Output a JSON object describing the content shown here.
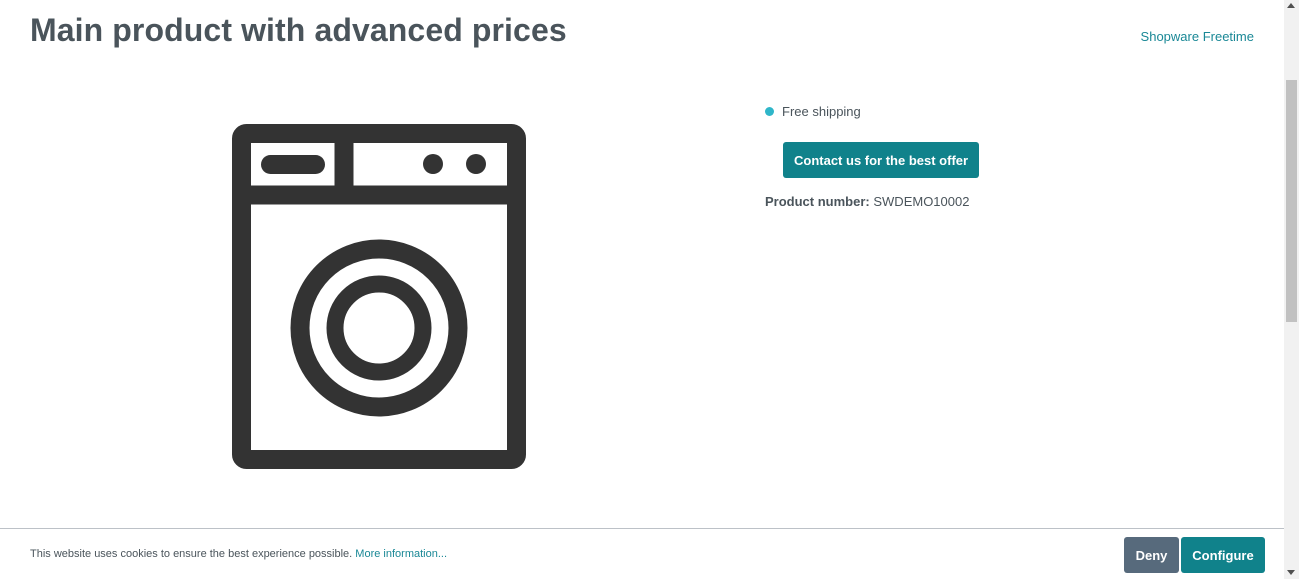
{
  "product": {
    "title": "Main product with advanced prices",
    "manufacturer": "Shopware Freetime",
    "image_icon": "washing-machine-icon",
    "delivery_text": "Free shipping",
    "contact_button_label": "Contact us for the best offer",
    "product_number_label": "Product number:",
    "product_number_value": "SWDEMO10002"
  },
  "cookie": {
    "text": "This website uses cookies to ensure the best experience possible.",
    "more_info": "More information...",
    "deny_label": "Deny",
    "configure_label": "Configure"
  },
  "colors": {
    "primary": "#10828b",
    "deny": "#576a7c",
    "text": "#4a545b",
    "delivery_dot": "#2fb6c9",
    "icon": "#333333"
  }
}
